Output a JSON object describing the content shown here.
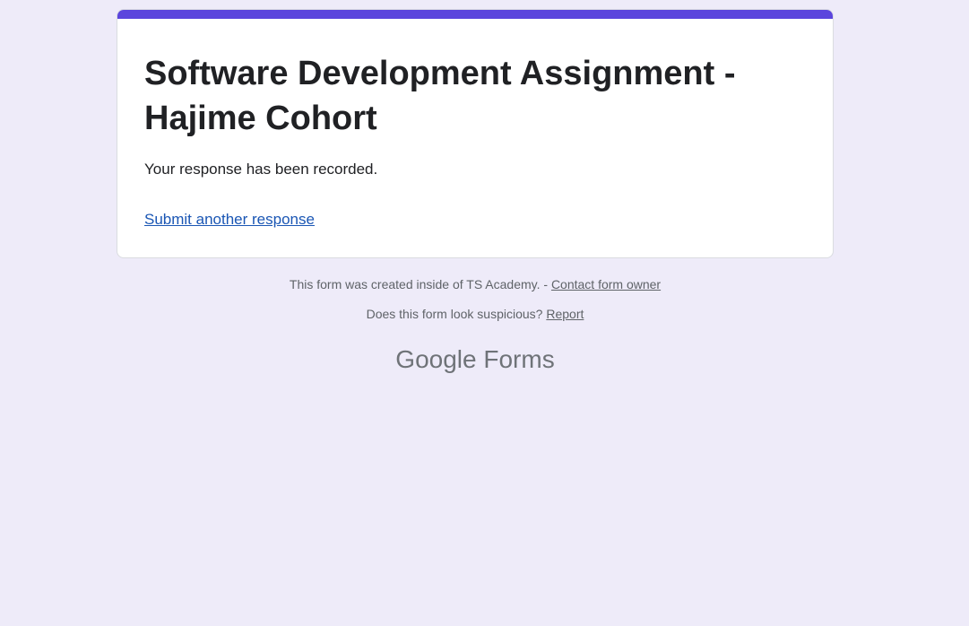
{
  "form": {
    "title": "Software Development Assignment - Hajime Cohort",
    "confirmation": "Your response has been recorded.",
    "submit_another_label": "Submit another response"
  },
  "footer": {
    "created_text": "This form was created inside of TS Academy. - ",
    "contact_label": "Contact form owner",
    "suspicious_text": "Does this form look suspicious? ",
    "report_label": "Report"
  },
  "brand": {
    "google": "Google",
    "forms": "Forms"
  },
  "colors": {
    "accent": "#5b45dd",
    "background": "#eeebf9",
    "link": "#1a56b4"
  }
}
